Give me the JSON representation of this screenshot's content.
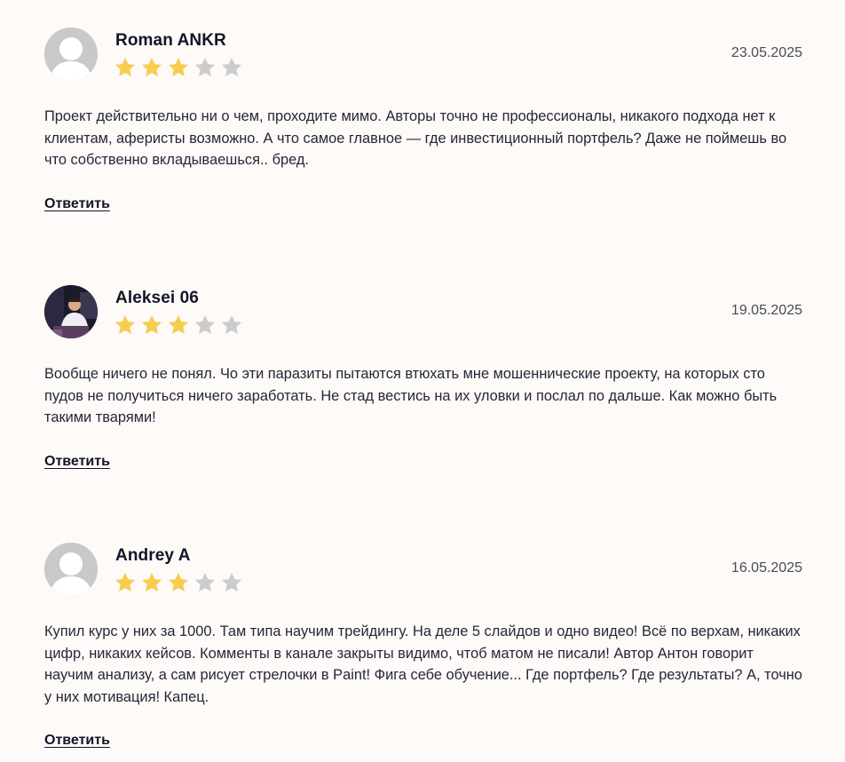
{
  "reviews": [
    {
      "author": "Roman ANKR",
      "date": "23.05.2025",
      "rating": 3,
      "max_rating": 5,
      "avatar": "default-avatar",
      "text": "Проект действительно ни о чем, проходите мимо. Авторы точно не профессионалы, никакого подхода нет к клиентам, аферисты возможно. А что самое главное — где инвестиционный портфель? Даже не поймешь во что собственно вкладываешься.. бред.",
      "reply_label": "Ответить"
    },
    {
      "author": "Aleksei 06",
      "date": "19.05.2025",
      "rating": 3,
      "max_rating": 5,
      "avatar": "photo-avatar",
      "text": "Вообще ничего не понял. Чо эти паразиты пытаются втюхать мне мошеннические проекту, на которых сто пудов не получиться ничего заработать. Не стад вестись на их уловки и послал по дальше. Как можно быть такими тварями!",
      "reply_label": "Ответить"
    },
    {
      "author": "Andrey A",
      "date": "16.05.2025",
      "rating": 3,
      "max_rating": 5,
      "avatar": "default-avatar",
      "text": "Купил курс у них за 1000. Там типа научим трейдингу. На деле 5 слайдов и одно видео! Всё по верхам, никаких цифр, никаких кейсов. Комменты в канале закрыты видимо, чтоб матом не писали! Автор Антон говорит научим анализу, а сам рисует стрелочки в Paint! Фига себе обучение... Где портфель? Где результаты? А, точно у них мотивация! Капец.",
      "reply_label": "Ответить"
    }
  ],
  "colors": {
    "background": "#fdfaf7",
    "star_filled": "#f7cd4f",
    "star_empty": "#cccccc",
    "avatar_default": "#c9c9c9"
  }
}
